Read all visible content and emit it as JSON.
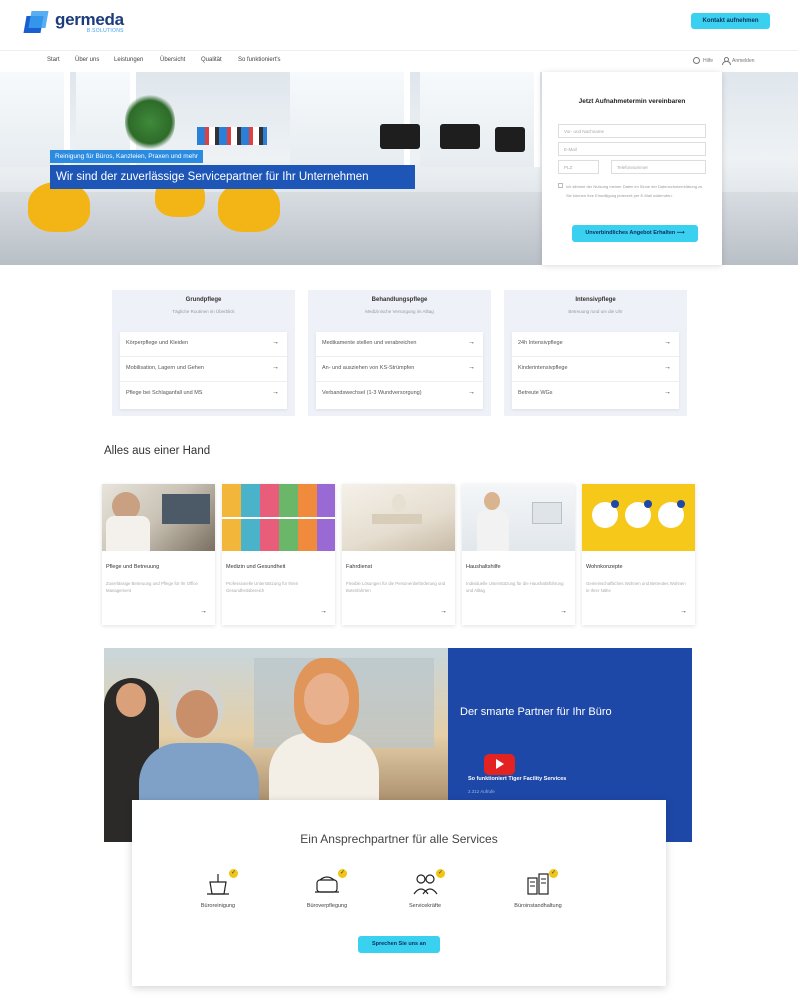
{
  "header": {
    "logo": {
      "name": "germeda",
      "sub": "B.SOLUTIONS"
    },
    "cta_label": "Kontakt aufnehmen"
  },
  "nav": {
    "items": [
      "Start",
      "Über uns",
      "Leistungen",
      "Übersicht",
      "Qualität",
      "So funktioniert's"
    ],
    "lang_label": "Hilfe",
    "login_label": "Anmelden"
  },
  "hero": {
    "tag": "Reinigung für Büros, Kanzleien, Praxen und mehr",
    "title": "Wir sind der zuverlässige Servicepartner für Ihr Unternehmen"
  },
  "form": {
    "title": "Jetzt Aufnahmetermin vereinbaren",
    "name_placeholder": "Vor- und Nachname",
    "email_placeholder": "E-Mail",
    "plz_placeholder": "PLZ",
    "phone_placeholder": "Telefonnummer",
    "consent": "Ich stimme der Nutzung meiner Daten im Sinne der Datenschutzerklärung zu. Sie können Ihre Einwilligung jederzeit per E-Mail widerrufen.",
    "submit_label": "Unverbindliches Angebot Erhalten ⟶"
  },
  "care": [
    {
      "title": "Grundpflege",
      "sub": "Tägliche Routinen im Überblick",
      "items": [
        "Körperpflege und Kleiden",
        "Mobilisation, Lagern und Gehen",
        "Pflege bei Schlaganfall und MS"
      ]
    },
    {
      "title": "Behandlungspflege",
      "sub": "Medizinische Versorgung im Alltag",
      "items": [
        "Medikamente stellen und verabreichen",
        "An- und ausziehen von KS-Strümpfen",
        "Verbandswechsel (1-3 Wundversorgung)"
      ]
    },
    {
      "title": "Intensivpflege",
      "sub": "Betreuung rund um die Uhr",
      "items": [
        "24h Intensivpflege",
        "Kinderintensivpflege",
        "Betreute WGs"
      ]
    }
  ],
  "services": {
    "title": "Alles aus einer Hand",
    "items": [
      {
        "name": "Pflege und Betreuung",
        "desc": "Zuverlässige Betreuung und Pflege für Ihr Office Management"
      },
      {
        "name": "Medizin und Gesundheit",
        "desc": "Professionelle Unterstützung für Ihren Gesundheitsbereich"
      },
      {
        "name": "Fahrdienst",
        "desc": "Flexible Lösungen für die Personenbeförderung und Botenfahrten"
      },
      {
        "name": "Haushaltshilfe",
        "desc": "Individuelle Unterstützung für die Haushaltsführung und Alltag"
      },
      {
        "name": "Wohnkonzepte",
        "desc": "Gemeinschaftliches Wohnen und Betreutes Wohnen in Ihrer Nähe"
      }
    ]
  },
  "video": {
    "title": "Der smarte Partner für Ihr Büro",
    "video_title": "So funktioniert Tiger Facility Services",
    "views": "2.312 Aufrufe"
  },
  "contact": {
    "title": "Ein Ansprechpartner für alle Services",
    "services": [
      "Büroreinigung",
      "Büroverpflegung",
      "Servicekräfte",
      "Büroinstandhaltung"
    ],
    "button_label": "Sprechen Sie uns an"
  },
  "colors": {
    "accent": "#3ad0f0",
    "brand_blue": "#1e48a8",
    "badge_yellow": "#f2c514",
    "chair_yellow": "#f3b516"
  }
}
